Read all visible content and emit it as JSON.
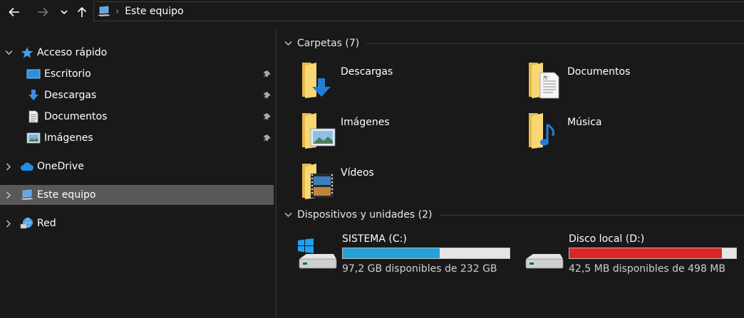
{
  "address": {
    "crumb": "Este equipo"
  },
  "icons": {
    "back": "arrow-left-icon",
    "forward": "arrow-right-icon",
    "recent": "chevron-down-icon",
    "up": "arrow-up-icon"
  },
  "nav": {
    "quick_access": "Acceso rápido",
    "desktop": "Escritorio",
    "downloads": "Descargas",
    "documents": "Documentos",
    "pictures": "Imágenes",
    "onedrive": "OneDrive",
    "this_pc": "Este equipo",
    "network": "Red"
  },
  "folders_group": {
    "title": "Carpetas (7)",
    "items": [
      "Descargas",
      "Documentos",
      "Imágenes",
      "Música",
      "Vídeos"
    ]
  },
  "devices_group": {
    "title": "Dispositivos y unidades (2)",
    "drives": [
      {
        "name": "SISTEMA (C:)",
        "free_text": "97,2 GB disponibles de 232 GB",
        "used_fraction": 0.58,
        "bar_color": "#26a0da"
      },
      {
        "name": "Disco local (D:)",
        "free_text": "42,5 MB disponibles de 498 MB",
        "used_fraction": 0.915,
        "bar_color": "#da2626"
      }
    ]
  },
  "colors": {
    "background": "#191919",
    "selected": "#585858",
    "accent_blue": "#26a0da",
    "warning_red": "#da2626",
    "folder_yellow": "#f8d775"
  }
}
